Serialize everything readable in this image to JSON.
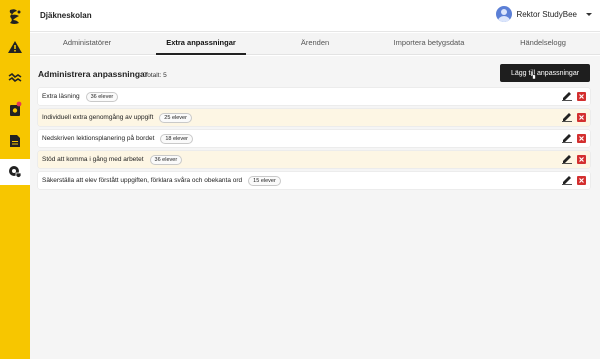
{
  "app": {
    "school_name": "Djäkneskolan"
  },
  "user": {
    "name": "Rektor StudyBee"
  },
  "tabs": [
    {
      "label": "Administatörer",
      "active": false
    },
    {
      "label": "Extra anpassningar",
      "active": true
    },
    {
      "label": "Ärenden",
      "active": false
    },
    {
      "label": "Importera betygsdata",
      "active": false
    },
    {
      "label": "Händelselogg",
      "active": false
    }
  ],
  "main": {
    "title": "Administrera anpassningar",
    "total": "Totalt: 5",
    "add_button": "Lägg till anpassningar"
  },
  "adaptations": [
    {
      "label": "Extra läsning",
      "count": "36 elever"
    },
    {
      "label": "Individuell extra genomgång av uppgift",
      "count": "25 elever"
    },
    {
      "label": "Nedskriven lektionsplanering på bordet",
      "count": "18 elever"
    },
    {
      "label": "Stöd att komma i gång med arbetet",
      "count": "36 elever"
    },
    {
      "label": "Säkerställa att elev förstått uppgiften, förklara svåra och obekanta ord",
      "count": "15 elever"
    }
  ],
  "colors": {
    "sidebar": "#f7c600",
    "delete": "#d32f2f",
    "row_alt": "#fdf6e4",
    "button": "#1e1e1e"
  },
  "icons": [
    "bee-logo-icon",
    "warning-icon",
    "trend-icon",
    "notification-camera-icon",
    "document-icon",
    "settings-shield-icon",
    "edit-icon",
    "delete-icon"
  ]
}
